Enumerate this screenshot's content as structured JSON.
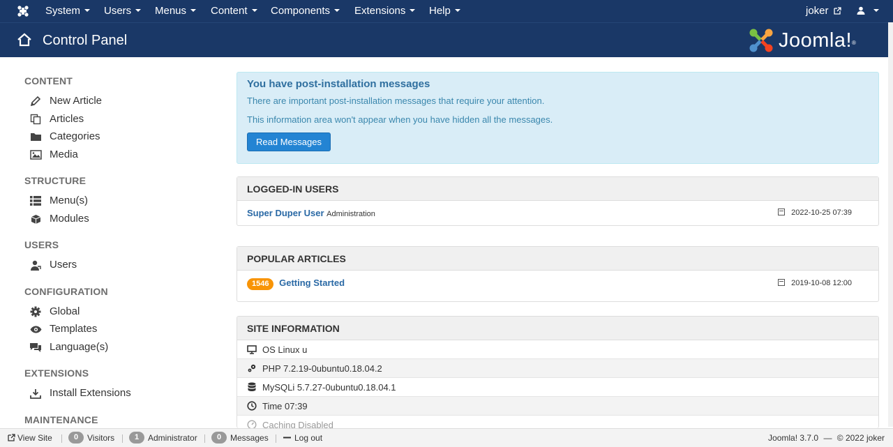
{
  "topnav": {
    "items": [
      {
        "label": "System"
      },
      {
        "label": "Users"
      },
      {
        "label": "Menus"
      },
      {
        "label": "Content"
      },
      {
        "label": "Components"
      },
      {
        "label": "Extensions"
      },
      {
        "label": "Help"
      }
    ],
    "user_link": "joker"
  },
  "header": {
    "title": "Control Panel",
    "logo_text": "Joomla!",
    "logo_mark": "®"
  },
  "sidebar": {
    "sections": [
      {
        "heading": "CONTENT",
        "items": [
          {
            "label": "New Article",
            "icon": "pencil-icon"
          },
          {
            "label": "Articles",
            "icon": "copy-icon"
          },
          {
            "label": "Categories",
            "icon": "folder-icon"
          },
          {
            "label": "Media",
            "icon": "image-icon"
          }
        ]
      },
      {
        "heading": "STRUCTURE",
        "items": [
          {
            "label": "Menu(s)",
            "icon": "list-icon"
          },
          {
            "label": "Modules",
            "icon": "cube-icon"
          }
        ]
      },
      {
        "heading": "USERS",
        "items": [
          {
            "label": "Users",
            "icon": "user-icon"
          }
        ]
      },
      {
        "heading": "CONFIGURATION",
        "items": [
          {
            "label": "Global",
            "icon": "cog-icon"
          },
          {
            "label": "Templates",
            "icon": "eye-icon"
          },
          {
            "label": "Language(s)",
            "icon": "comments-icon"
          }
        ]
      },
      {
        "heading": "EXTENSIONS",
        "items": [
          {
            "label": "Install Extensions",
            "icon": "download-icon"
          }
        ]
      },
      {
        "heading": "MAINTENANCE",
        "items": []
      }
    ]
  },
  "alert": {
    "heading": "You have post-installation messages",
    "line1": "There are important post-installation messages that require your attention.",
    "line2": "This information area won't appear when you have hidden all the messages.",
    "button": "Read Messages"
  },
  "logged_in": {
    "heading": "LOGGED-IN USERS",
    "rows": [
      {
        "name": "Super Duper User",
        "area": "Administration",
        "date": "2022-10-25 07:39"
      }
    ]
  },
  "popular": {
    "heading": "POPULAR ARTICLES",
    "rows": [
      {
        "hits": "1546",
        "title": "Getting Started",
        "date": "2019-10-08 12:00"
      }
    ]
  },
  "site_info": {
    "heading": "SITE INFORMATION",
    "rows": [
      {
        "text": "OS Linux u",
        "icon": "monitor-icon"
      },
      {
        "text": "PHP 7.2.19-0ubuntu0.18.04.2",
        "icon": "cogs-icon"
      },
      {
        "text": "MySQLi 5.7.27-0ubuntu0.18.04.1",
        "icon": "database-icon"
      },
      {
        "text": "Time 07:39",
        "icon": "clock-icon"
      },
      {
        "text": "Caching Disabled",
        "icon": "dashboard-icon"
      }
    ]
  },
  "footer": {
    "view_site": "View Site",
    "visitors_count": "0",
    "visitors_label": "Visitors",
    "admin_count": "1",
    "admin_label": "Administrator",
    "messages_count": "0",
    "messages_label": "Messages",
    "logout": "Log out",
    "version": "Joomla! 3.7.0",
    "separator": "—",
    "copyright": "© 2022 joker"
  },
  "colors": {
    "navbar": "#1a3867",
    "alert_bg": "#d9edf7",
    "button": "#2384d3",
    "badge_orange": "#f89406",
    "link": "#2a69a5"
  }
}
